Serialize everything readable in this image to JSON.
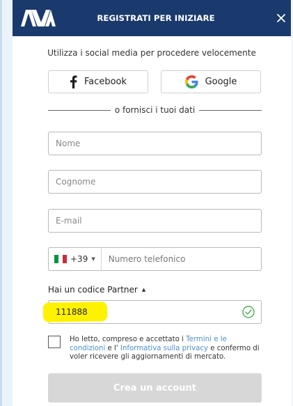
{
  "header": {
    "logo_text": "AVA",
    "title": "REGISTRATI PER INIZIARE",
    "close_symbol": "×",
    "background_color": "#1a3a6d"
  },
  "social": {
    "intro": "Utilizza i social media per procedere velocemente",
    "facebook_label": "Facebook",
    "google_label": "Google",
    "separator_text": "o fornisci i tuoi dati"
  },
  "form": {
    "name_placeholder": "Nome",
    "surname_placeholder": "Cognome",
    "email_placeholder": "E-mail",
    "phone": {
      "country_code": "+39",
      "placeholder": "Numero telefonico"
    },
    "partner": {
      "label": "Hai un codice Partner",
      "value": "111888"
    },
    "terms": {
      "prefix": "Ho letto, compreso e accettato i ",
      "terms_link": "Termini e le condizioni",
      "middle": " e l' ",
      "privacy_link": "Informativa sulla privacy",
      "suffix": " e confermo di voler ricevere gli aggiornamenti di mercato."
    },
    "submit_label": "Crea un account"
  },
  "colors": {
    "accent": "#1a3a6d",
    "link": "#4b8fcd",
    "success": "#4caf50",
    "highlight": "#fff200",
    "disabled_button": "#d7d7d7"
  },
  "icons": {
    "logo": "ava-logo-icon",
    "close": "close-icon",
    "facebook": "facebook-icon",
    "google": "google-icon",
    "flag": "italy-flag-icon",
    "dropdown": "chevron-down-icon",
    "collapse": "chevron-up-icon",
    "valid": "check-circle-icon"
  }
}
